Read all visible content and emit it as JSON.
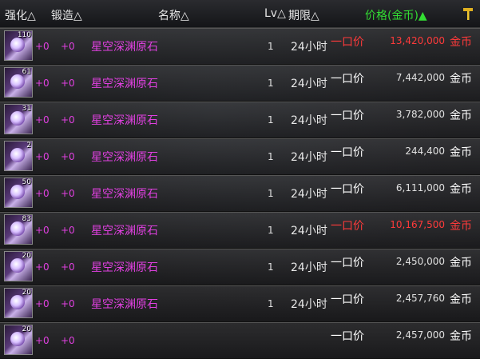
{
  "header": {
    "col_enhance": "强化△",
    "col_forge": "锻造△",
    "col_name": "名称△",
    "col_lv": "Lv△",
    "col_duration": "期限△",
    "col_price": "价格(金币)▲",
    "sort_icon": "hammer-icon",
    "price_color": "#33dd33"
  },
  "rows": [
    {
      "stack": "110",
      "enhance": "+0",
      "forge": "+0",
      "name": "星空深渊原石",
      "lv": "1",
      "duration": "24小时",
      "price_type": "一口价",
      "price": "13,420,000",
      "currency": "金币",
      "highlight": true
    },
    {
      "stack": "61",
      "enhance": "+0",
      "forge": "+0",
      "name": "星空深渊原石",
      "lv": "1",
      "duration": "24小时",
      "price_type": "一口价",
      "price": "7,442,000",
      "currency": "金币",
      "highlight": false
    },
    {
      "stack": "31",
      "enhance": "+0",
      "forge": "+0",
      "name": "星空深渊原石",
      "lv": "1",
      "duration": "24小时",
      "price_type": "一口价",
      "price": "3,782,000",
      "currency": "金币",
      "highlight": false
    },
    {
      "stack": "2",
      "enhance": "+0",
      "forge": "+0",
      "name": "星空深渊原石",
      "lv": "1",
      "duration": "24小时",
      "price_type": "一口价",
      "price": "244,400",
      "currency": "金币",
      "highlight": false
    },
    {
      "stack": "50",
      "enhance": "+0",
      "forge": "+0",
      "name": "星空深渊原石",
      "lv": "1",
      "duration": "24小时",
      "price_type": "一口价",
      "price": "6,111,000",
      "currency": "金币",
      "highlight": false
    },
    {
      "stack": "83",
      "enhance": "+0",
      "forge": "+0",
      "name": "星空深渊原石",
      "lv": "1",
      "duration": "24小时",
      "price_type": "一口价",
      "price": "10,167,500",
      "currency": "金币",
      "highlight": true
    },
    {
      "stack": "20",
      "enhance": "+0",
      "forge": "+0",
      "name": "星空深渊原石",
      "lv": "1",
      "duration": "24小时",
      "price_type": "一口价",
      "price": "2,450,000",
      "currency": "金币",
      "highlight": false
    },
    {
      "stack": "20",
      "enhance": "+0",
      "forge": "+0",
      "name": "星空深渊原石",
      "lv": "1",
      "duration": "24小时",
      "price_type": "一口价",
      "price": "2,457,760",
      "currency": "金币",
      "highlight": false
    },
    {
      "stack": "20",
      "enhance": "+0",
      "forge": "+0",
      "name": "",
      "lv": "",
      "duration": "",
      "price_type": "一口价",
      "price": "2,457,000",
      "currency": "金币",
      "highlight": false
    }
  ],
  "colors": {
    "item_name": "#e040e0",
    "highlight": "#ff3a3a",
    "normal": "#ffffff"
  }
}
